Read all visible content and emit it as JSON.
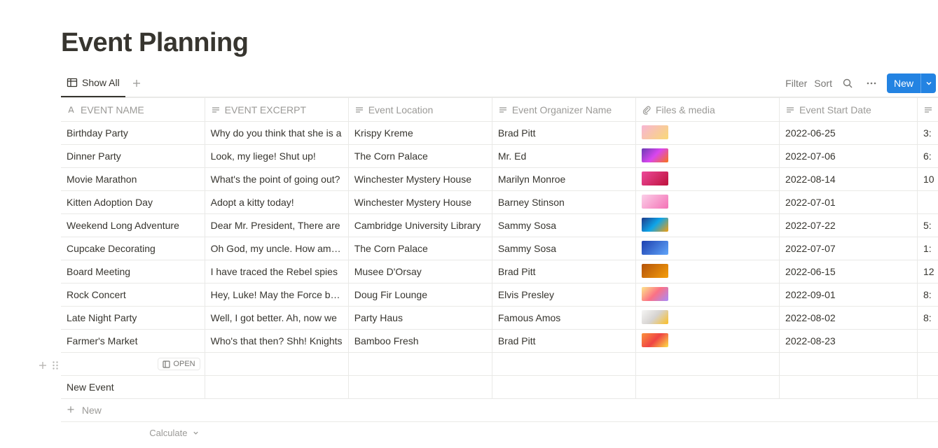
{
  "title": "Event Planning",
  "tabs": {
    "active": "Show All"
  },
  "controls": {
    "filter": "Filter",
    "sort": "Sort",
    "new": "New"
  },
  "columns": {
    "name": "EVENT NAME",
    "excerpt": "EVENT EXCERPT",
    "location": "Event Location",
    "organizer": "Event Organizer Name",
    "files": "Files & media",
    "start": "Event Start Date"
  },
  "rows": [
    {
      "name": "Birthday Party",
      "excerpt": "Why do you think that she is a",
      "location": "Krispy Kreme",
      "organizer": "Brad Pitt",
      "thumb": "t0",
      "start": "2022-06-25",
      "time": "3:"
    },
    {
      "name": "Dinner Party",
      "excerpt": "Look, my liege! Shut up!",
      "location": "The Corn Palace",
      "organizer": "Mr. Ed",
      "thumb": "t1",
      "start": "2022-07-06",
      "time": "6:"
    },
    {
      "name": "Movie Marathon",
      "excerpt": "What's the point of going out?",
      "location": "Winchester Mystery House",
      "organizer": "Marilyn Monroe",
      "thumb": "t2",
      "start": "2022-08-14",
      "time": "10"
    },
    {
      "name": "Kitten Adoption Day",
      "excerpt": "Adopt a kitty today!",
      "location": "Winchester Mystery House",
      "organizer": "Barney Stinson",
      "thumb": "t3",
      "start": "2022-07-01",
      "time": ""
    },
    {
      "name": "Weekend Long Adventure",
      "excerpt": "Dear Mr. President, There are",
      "location": "Cambridge University Library",
      "organizer": "Sammy Sosa",
      "thumb": "t4",
      "start": "2022-07-22",
      "time": "5:"
    },
    {
      "name": "Cupcake Decorating",
      "excerpt": "Oh God, my uncle. How am I e",
      "location": "The Corn Palace",
      "organizer": "Sammy Sosa",
      "thumb": "t5",
      "start": "2022-07-07",
      "time": "1:"
    },
    {
      "name": "Board Meeting",
      "excerpt": "I have traced the Rebel spies",
      "location": "Musee D'Orsay",
      "organizer": "Brad Pitt",
      "thumb": "t6",
      "start": "2022-06-15",
      "time": "12"
    },
    {
      "name": "Rock Concert",
      "excerpt": "Hey, Luke! May the Force be w",
      "location": "Doug Fir Lounge",
      "organizer": "Elvis Presley",
      "thumb": "t7",
      "start": "2022-09-01",
      "time": "8:"
    },
    {
      "name": "Late Night Party",
      "excerpt": "Well, I got better. Ah, now we",
      "location": "Party Haus",
      "organizer": "Famous Amos",
      "thumb": "t8",
      "start": "2022-08-02",
      "time": "8:"
    },
    {
      "name": "Farmer's Market",
      "excerpt": "Who's that then? Shh! Knights",
      "location": "Bamboo Fresh",
      "organizer": "Brad Pitt",
      "thumb": "t9",
      "start": "2022-08-23",
      "time": ""
    }
  ],
  "blank_row": {
    "open_label": "OPEN"
  },
  "tail_rows": [
    {
      "name": "New Event"
    }
  ],
  "new_row_label": "New",
  "calculate_label": "Calculate"
}
